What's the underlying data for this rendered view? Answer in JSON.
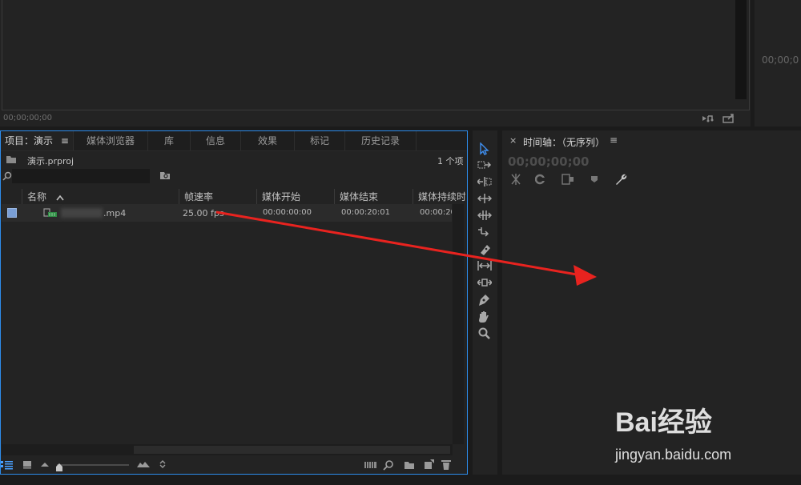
{
  "source_monitor": {
    "timecode": "00;00;00;00"
  },
  "program_monitor": {
    "timecode": "00;00;0"
  },
  "project": {
    "tabs": [
      {
        "label": "项目：演示"
      },
      {
        "label": "媒体浏览器"
      },
      {
        "label": "库"
      },
      {
        "label": "信息"
      },
      {
        "label": "效果"
      },
      {
        "label": "标记"
      },
      {
        "label": "历史记录"
      }
    ],
    "menu_glyph": "≡",
    "project_file": "演示.prproj",
    "item_count": "1 个项",
    "columns": {
      "name": "名称",
      "framerate": "帧速率",
      "media_start": "媒体开始",
      "media_end": "媒体结束",
      "media_duration": "媒体持续时"
    },
    "rows": [
      {
        "name": ".mp4",
        "framerate": "25.00 fps",
        "media_start": "00:00:00:00",
        "media_end": "00:00:20:01",
        "media_duration": "00:00:20"
      }
    ],
    "accent_color": "#2d8ceb",
    "label_color": "#7a9fd6"
  },
  "timeline": {
    "close": "×",
    "title": "时间轴：（无序列）",
    "menu_glyph": "≡",
    "timecode": "00;00;00;00"
  },
  "annotation": {
    "arrow_color": "#e8231f"
  },
  "watermark": {
    "text": "Bai经验",
    "url": "jingyan.baidu.com"
  }
}
